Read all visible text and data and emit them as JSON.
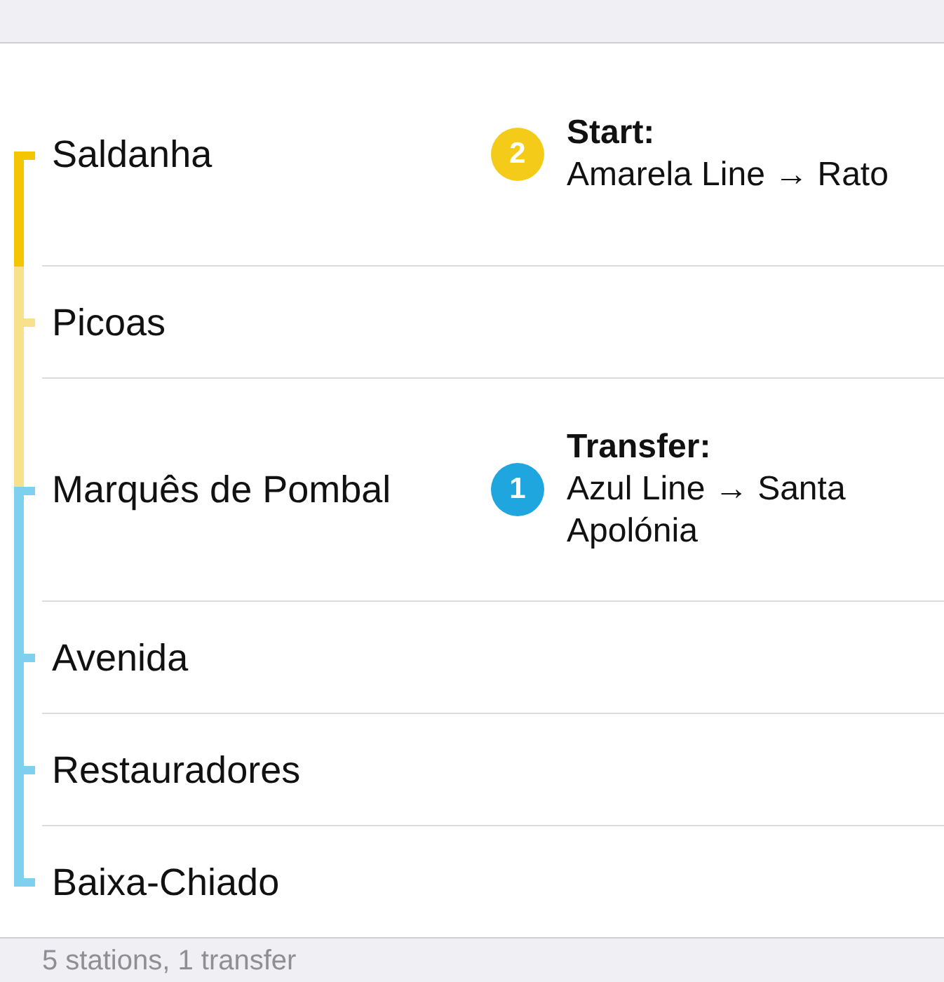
{
  "stations": [
    {
      "name": "Saldanha",
      "kind": "start",
      "color": "#f3c600",
      "note": {
        "badge": "2",
        "color": "#f5cb1a",
        "title": "Start:",
        "text": "Amarela Line → Rato"
      }
    },
    {
      "name": "Picoas",
      "kind": "stop",
      "color": "#f8e08c"
    },
    {
      "name": "Marquês de Pombal",
      "kind": "transfer",
      "color": "#7fcfee",
      "note": {
        "badge": "1",
        "color": "#1fa6df",
        "title": "Transfer:",
        "text": "Azul Line → Santa Apolónia"
      }
    },
    {
      "name": "Avenida",
      "kind": "stop",
      "color": "#7fcfee"
    },
    {
      "name": "Restauradores",
      "kind": "stop",
      "color": "#7fcfee"
    },
    {
      "name": "Baixa-Chiado",
      "kind": "end",
      "color": "#7fcfee"
    }
  ],
  "summary": "5 stations, 1 transfer"
}
